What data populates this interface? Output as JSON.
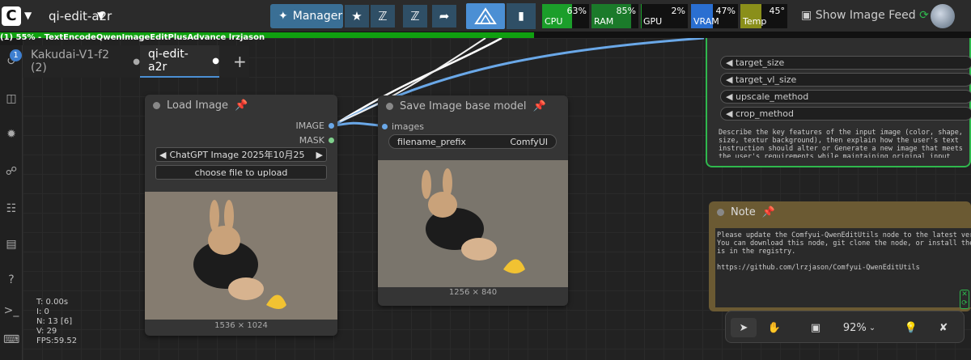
{
  "topbar": {
    "workflow_title": "qi-edit-a2r",
    "manager_label": "Manager",
    "stats": [
      {
        "label": "CPU",
        "value": "63%",
        "fraction": 0.63,
        "color": "#1b9e2a"
      },
      {
        "label": "RAM",
        "value": "85%",
        "fraction": 0.85,
        "color": "#1b7a2a"
      },
      {
        "label": "GPU",
        "value": "2%",
        "fraction": 0.02,
        "color": "#1b9e2a"
      },
      {
        "label": "VRAM",
        "value": "47%",
        "fraction": 0.47,
        "color": "#2a6fd1"
      },
      {
        "label": "Temp",
        "value": "45°",
        "fraction": 0.45,
        "color": "#8a8f1a"
      }
    ],
    "image_feed_label": "Show Image Feed"
  },
  "progress": {
    "fraction": 0.55,
    "status_text": "(1) 55% - TextEncodeQwenImageEditPlusAdvance lrzjason"
  },
  "tabs": {
    "badge": "1",
    "items": [
      "Kakudai-V1-f2 (2)",
      "qi-edit-a2r"
    ],
    "add_label": "+"
  },
  "load_image_node": {
    "title": "Load Image",
    "output_image": "IMAGE",
    "output_mask": "MASK",
    "image_selector": "ChatGPT Image 2025年10月25",
    "upload_label": "choose file to upload",
    "caption": "1536 × 1024"
  },
  "save_image_node": {
    "title": "Save Image base model",
    "input_images": "images",
    "filename_label": "filename_prefix",
    "filename_value": "ComfyUI",
    "caption": "1256 × 840"
  },
  "right_node": {
    "params": [
      "target_size",
      "target_vl_size",
      "upscale_method",
      "crop_method"
    ],
    "description": "Describe the key features of the input image (color, shape, size, textur background), then explain how the user's text instruction should alter or Generate a new image that meets the user's requirements while maintaining original input where appropriate."
  },
  "note_node": {
    "title": "Note",
    "text": "Please update the Comfyui-QwenEditUtils node to the latest version or ni\nYou can download this node, git clone the node, or install the node in C\nis in the registry.\n\nhttps://github.com/lrzjason/Comfyui-QwenEditUtils"
  },
  "canvas_stats": [
    "T: 0.00s",
    "I: 0",
    "N: 13 [6]",
    "V: 29",
    "FPS:59.52"
  ],
  "toolbar": {
    "zoom": "92%"
  },
  "colors": {
    "accent": "#4b8fd4",
    "green": "#10a010",
    "link_blue": "#6aa8e8"
  }
}
